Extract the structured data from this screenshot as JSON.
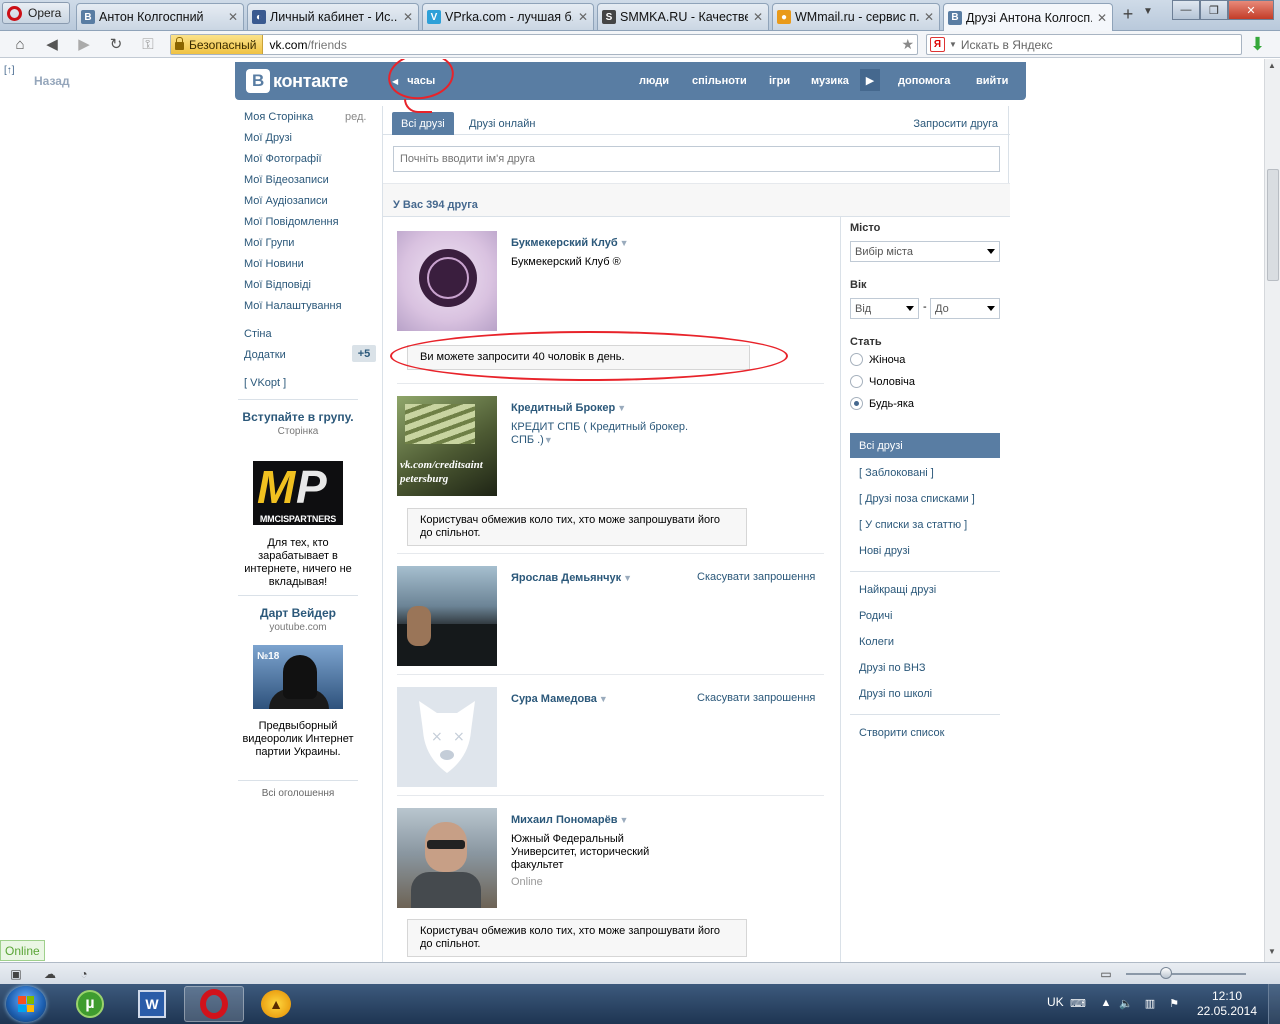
{
  "browser": {
    "menu_label": "Opera",
    "tabs": [
      {
        "title": "Антон Колгоспний",
        "icon": "В",
        "color": "#597da3"
      },
      {
        "title": "Личный кабинет - Ис...",
        "icon": "◐",
        "color": "#3a5a90"
      },
      {
        "title": "VPrka.com - лучшая б...",
        "icon": "V",
        "color": "#2da0d8"
      },
      {
        "title": "SMMKA.RU - Качестве...",
        "icon": "S",
        "color": "#444444"
      },
      {
        "title": "WMmail.ru - сервис п...",
        "icon": "●",
        "color": "#e99a1a"
      },
      {
        "title": "Друзі Антона Колгосп...",
        "icon": "В",
        "color": "#597da3"
      }
    ],
    "security_label": "Безопасный",
    "url_host": "vk.com",
    "url_path": "/friends",
    "search_placeholder": "Искать в Яндекс",
    "status_online": "Online"
  },
  "page": {
    "back_label": "Назад",
    "back_marker": "[↑]",
    "header": {
      "logo_text": "контакте",
      "logo_letter": "В",
      "back_link": "часы",
      "nav": [
        "люди",
        "спільноти",
        "ігри",
        "музика",
        "допомога",
        "вийти"
      ]
    },
    "left_menu": {
      "items": [
        "Моя Сторінка",
        "Мої Друзі",
        "Мої Фотографії",
        "Мої Відеозаписи",
        "Мої Аудіозаписи",
        "Мої Повідомлення",
        "Мої Групи",
        "Мої Новини",
        "Мої Відповіді",
        "Мої Налаштування"
      ],
      "edit_label": "ред.",
      "extra": [
        "Стіна",
        "Додатки",
        "[ VKopt ]"
      ],
      "apps_badge": "+5"
    },
    "ads": [
      {
        "title": "Вступайте в групу.",
        "subtitle": "Сторінка",
        "logo_text": "MMCISPARTNERS",
        "text": "Для тех, кто зарабатывает в интернете, ничего не вкладывая!"
      },
      {
        "title": "Дарт Вейдер",
        "subtitle": "youtube.com",
        "badge": "№18",
        "text": "Предвыборный видеоролик Интернет партии Украины."
      }
    ],
    "all_ads_label": "Всі оголошення",
    "tabs": {
      "all": "Всі друзі",
      "online": "Друзі онлайн",
      "invite": "Запросити друга"
    },
    "search_placeholder": "Почніть вводити ім'я друга",
    "friends_count": "У Вас 394 друга",
    "friends": [
      {
        "name": "Букмекерский Клуб",
        "desc": "Букмекерский Клуб ®"
      },
      {
        "name": "Кредитный Брокер",
        "desc": "КРЕДИТ СПБ ( Кредитный брокер. СПБ .)",
        "photo_text_1": "vk.com/creditsaint",
        "photo_text_2": "petersburg"
      },
      {
        "name": "Ярослав Демьянчук",
        "action": "Скасувати запрошення"
      },
      {
        "name": "Сура Мамедова",
        "action": "Скасувати запрошення"
      },
      {
        "name": "Михаил Пономарёв",
        "desc": "Южный Федеральный Университет, исторический факультет",
        "online": "Online"
      }
    ],
    "notices": {
      "limit": "Ви можете запросити 40 чоловік в день.",
      "restricted": "Користувач обмежив коло тих, хто може запрошувати його до спільнот."
    },
    "filters": {
      "city_label": "Місто",
      "city_placeholder": "Вибір міста",
      "age_label": "Вік",
      "age_from": "Від",
      "age_dash": "-",
      "age_to": "До",
      "sex_label": "Стать",
      "sex_options": [
        "Жіноча",
        "Чоловіча",
        "Будь-яка"
      ],
      "lists": [
        "Всі друзі",
        "[ Заблоковані ]",
        "[ Друзі поза списками ]",
        "[ У списки за статтю ]",
        "Нові друзі"
      ],
      "groups": [
        "Найкращі друзі",
        "Родичі",
        "Колеги",
        "Друзі по ВНЗ",
        "Друзі по школі"
      ],
      "create_list": "Створити список"
    }
  },
  "taskbar": {
    "lang": "UK",
    "time": "12:10",
    "date": "22.05.2014"
  }
}
